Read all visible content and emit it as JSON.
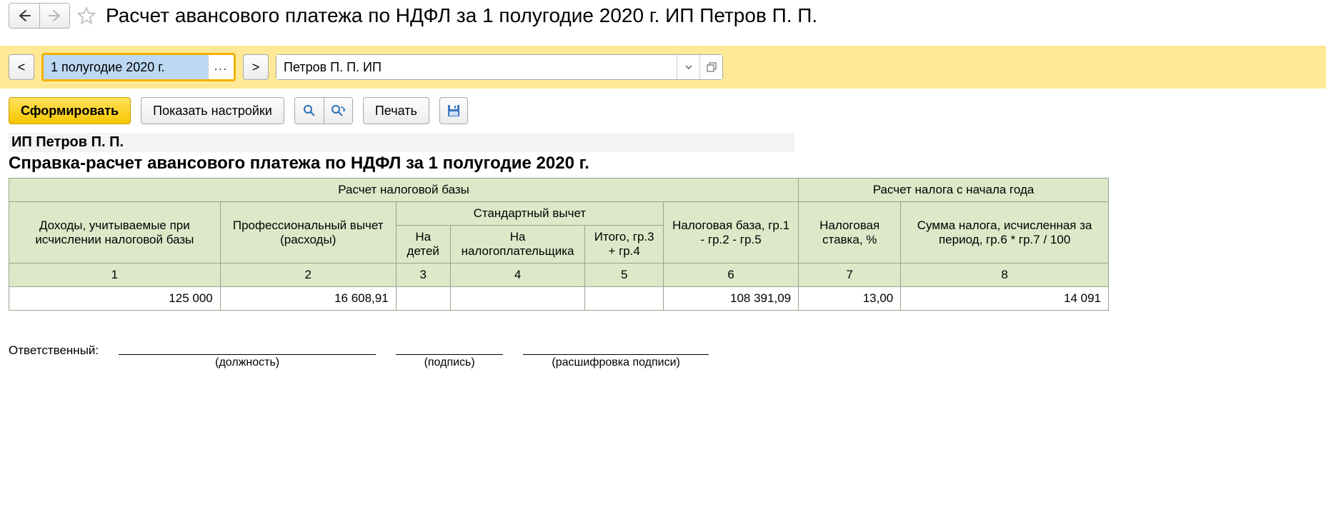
{
  "header": {
    "title": "Расчет авансового платежа по НДФЛ за 1 полугодие 2020 г. ИП Петров П. П."
  },
  "params": {
    "period": "1 полугодие 2020 г.",
    "organization": "Петров П. П. ИП"
  },
  "toolbar": {
    "generate": "Сформировать",
    "show_settings": "Показать настройки",
    "print": "Печать"
  },
  "report": {
    "org": "ИП Петров П. П.",
    "title": "Справка-расчет авансового платежа по НДФЛ за 1 полугодие 2020 г.",
    "group_base": "Расчет налоговой базы",
    "group_tax": "Расчет налога с начала года",
    "group_std": "Стандартный вычет",
    "cols": {
      "c1": "Доходы, учитываемые при исчислении налоговой базы",
      "c2": "Профессиональный вычет (расходы)",
      "c3": "На детей",
      "c4": "На налогоплательщика",
      "c5": "Итого, гр.3 + гр.4",
      "c6": "Налоговая база, гр.1 - гр.2 - гр.5",
      "c7": "Налоговая ставка, %",
      "c8": "Сумма налога, исчисленная за период, гр.6 * гр.7 / 100"
    },
    "nums": {
      "n1": "1",
      "n2": "2",
      "n3": "3",
      "n4": "4",
      "n5": "5",
      "n6": "6",
      "n7": "7",
      "n8": "8"
    },
    "row": {
      "c1": "125 000",
      "c2": "16 608,91",
      "c3": "",
      "c4": "",
      "c5": "",
      "c6": "108 391,09",
      "c7": "13,00",
      "c8": "14 091"
    }
  },
  "sign": {
    "label": "Ответственный:",
    "position": "(должность)",
    "signature": "(подпись)",
    "decode": "(расшифровка подписи)"
  },
  "chart_data": {
    "type": "table",
    "title": "Справка-расчет авансового платежа по НДФЛ за 1 полугодие 2020 г.",
    "columns": [
      "Доходы, учитываемые при исчислении налоговой базы",
      "Профессиональный вычет (расходы)",
      "Стандартный вычет — На детей",
      "Стандартный вычет — На налогоплательщика",
      "Стандартный вычет — Итого, гр.3 + гр.4",
      "Налоговая база, гр.1 - гр.2 - гр.5",
      "Налоговая ставка, %",
      "Сумма налога, исчисленная за период, гр.6 * гр.7 / 100"
    ],
    "rows": [
      [
        125000,
        16608.91,
        null,
        null,
        null,
        108391.09,
        13.0,
        14091
      ]
    ]
  }
}
